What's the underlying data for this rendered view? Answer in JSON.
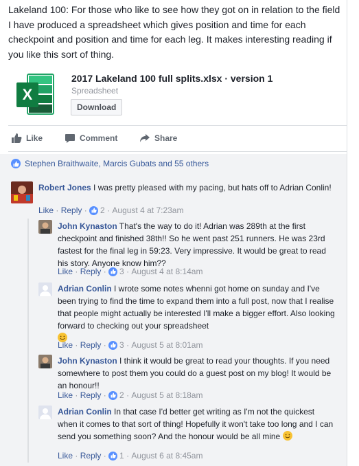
{
  "post": {
    "text": "Lakeland 100: For those who like to see how they got on in relation to the field I have produced a spreadsheet which gives position and time for each checkpoint and position and time for each leg. It makes interesting reading if you like this sort of thing.",
    "attachment": {
      "icon": "excel-file-icon",
      "title": "2017 Lakeland 100 full splits.xlsx · version 1",
      "type": "Spreadsheet",
      "download_label": "Download"
    }
  },
  "actions": {
    "like": "Like",
    "comment": "Comment",
    "share": "Share"
  },
  "reactions": {
    "icon": "like-reaction-icon",
    "summary": "Stephen Braithwaite, Marcis Gubats and 55 others"
  },
  "colors": {
    "link": "#385898",
    "like_blue": "#5890ff",
    "excel_green": "#1e7145"
  },
  "comments": [
    {
      "author": "Robert Jones",
      "text": "I was pretty pleased with my pacing, but hats off to Adrian Conlin!",
      "like": "Like",
      "reply": "Reply",
      "likes": "2",
      "time": "August 4 at 7:23am"
    },
    {
      "author": "John Kynaston",
      "text": "That's the way to do it! Adrian was 289th at the first checkpoint and finished 38th!! So he went past 251 runners. He was 23rd fastest for the final leg in 59:23. Very impressive. It would be great to read his story. Anyone know him??",
      "like": "Like",
      "reply": "Reply",
      "likes": "3",
      "time": "August 4 at 8:14am"
    },
    {
      "author": "Adrian Conlin",
      "text": "I wrote some notes whenni got home on sunday and I've been trying to find the time to expand them into a full post, now that I realise that people might actually be interested I'll make a bigger effort. Also looking forward to checking out your spreadsheet",
      "like": "Like",
      "reply": "Reply",
      "likes": "3",
      "time": "August 5 at 8:01am"
    },
    {
      "author": "John Kynaston",
      "text": "I think it would be great to read your thoughts. If you need somewhere to post them you could do a guest post on my blog! It would be an honour!!",
      "like": "Like",
      "reply": "Reply",
      "likes": "2",
      "time": "August 5 at 8:18am"
    },
    {
      "author": "Adrian Conlin",
      "text": "In that case I'd better get writing as I'm not the quickest when it comes to that sort of thing! Hopefully it won't take too long and I can send you something soon? And the honour would be all mine",
      "like": "Like",
      "reply": "Reply",
      "likes": "1",
      "time": "August 6 at 8:45am"
    }
  ]
}
